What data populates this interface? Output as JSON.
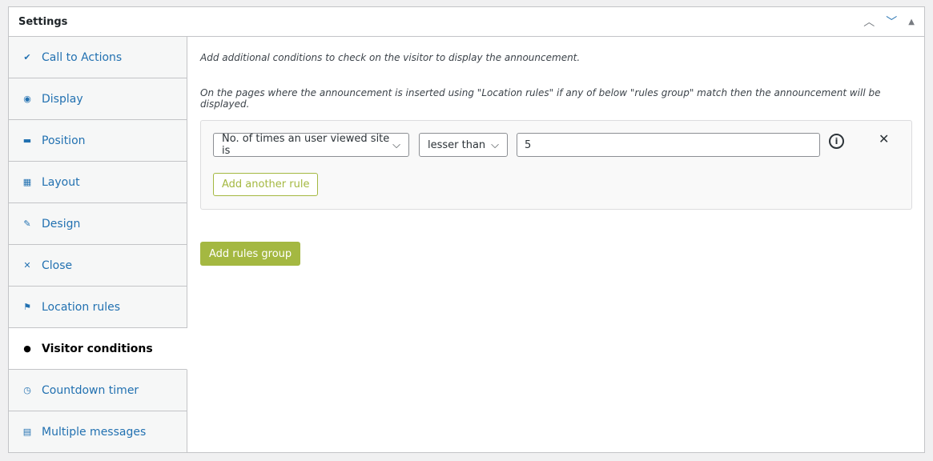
{
  "header": {
    "title": "Settings"
  },
  "sidebar": {
    "items": [
      {
        "label": "Call to Actions",
        "icon": "✔"
      },
      {
        "label": "Display",
        "icon": "◉"
      },
      {
        "label": "Position",
        "icon": "▬"
      },
      {
        "label": "Layout",
        "icon": "▦"
      },
      {
        "label": "Design",
        "icon": "✎"
      },
      {
        "label": "Close",
        "icon": "✕"
      },
      {
        "label": "Location rules",
        "icon": "⚑"
      },
      {
        "label": "Visitor conditions",
        "icon": "●"
      },
      {
        "label": "Countdown timer",
        "icon": "◷"
      },
      {
        "label": "Multiple messages",
        "icon": "▤"
      }
    ],
    "active_index": 7
  },
  "main": {
    "note1": "Add additional conditions to check on the visitor to display the announcement.",
    "note2": "On the pages where the announcement is inserted using \"Location rules\" if any of below \"rules group\" match then the announcement will be displayed.",
    "rule": {
      "field": "No. of times an user viewed site is",
      "operator": "lesser than",
      "value": "5"
    },
    "add_rule": "Add another rule",
    "add_group": "Add rules group"
  },
  "colors": {
    "accent": "#a4b841",
    "link": "#2271b1"
  }
}
